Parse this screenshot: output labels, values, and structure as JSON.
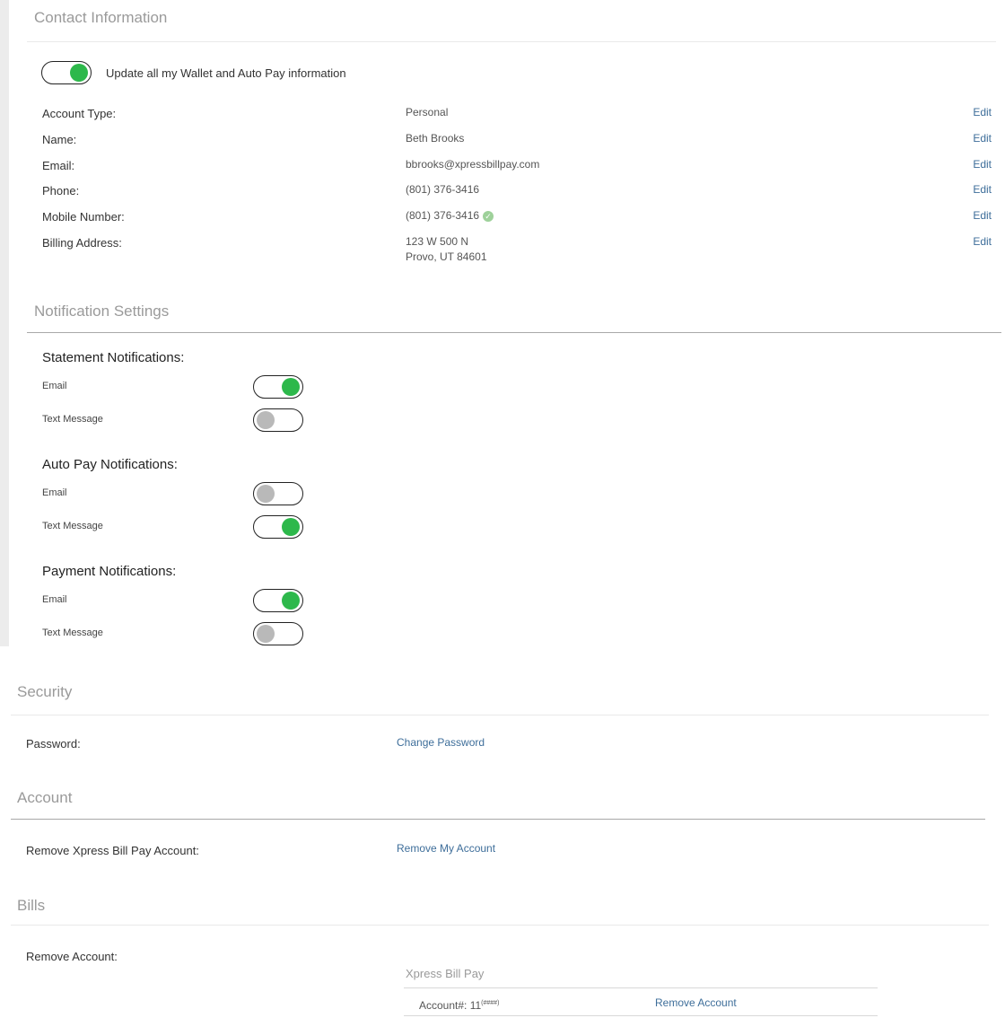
{
  "contact": {
    "title": "Contact Information",
    "update_all_label": "Update all my Wallet and Auto Pay information",
    "update_all_on": true,
    "edit_label": "Edit",
    "rows": [
      {
        "label": "Account Type:",
        "value": "Personal"
      },
      {
        "label": "Name:",
        "value": "Beth Brooks"
      },
      {
        "label": "Email:",
        "value": "bbrooks@xpressbillpay.com"
      },
      {
        "label": "Phone:",
        "value": "(801) 376-3416"
      },
      {
        "label": "Mobile Number:",
        "value": "(801) 376-3416",
        "verified": true
      },
      {
        "label": "Billing Address:",
        "value": "123 W 500 N",
        "value2": "Provo, UT 84601"
      }
    ]
  },
  "notifications": {
    "title": "Notification Settings",
    "groups": [
      {
        "title": "Statement Notifications:",
        "items": [
          {
            "label": "Email",
            "on": true
          },
          {
            "label": "Text Message",
            "on": false
          }
        ]
      },
      {
        "title": "Auto Pay Notifications:",
        "items": [
          {
            "label": "Email",
            "on": false
          },
          {
            "label": "Text Message",
            "on": true
          }
        ]
      },
      {
        "title": "Payment Notifications:",
        "items": [
          {
            "label": "Email",
            "on": true
          },
          {
            "label": "Text Message",
            "on": false
          }
        ]
      }
    ]
  },
  "security": {
    "title": "Security",
    "password_label": "Password:",
    "change_password": "Change Password"
  },
  "account": {
    "title": "Account",
    "remove_label": "Remove Xpress Bill Pay Account:",
    "remove_link": "Remove My Account"
  },
  "bills": {
    "title": "Bills",
    "remove_label": "Remove Account:",
    "provider": "Xpress Bill Pay",
    "account_number": "Account#: 11",
    "account_suffix": "(####)",
    "remove_link": "Remove Account"
  },
  "colors": {
    "toggle_on": "#2db84b",
    "toggle_off": "#b9b9b9",
    "link": "#3e6e9a"
  }
}
